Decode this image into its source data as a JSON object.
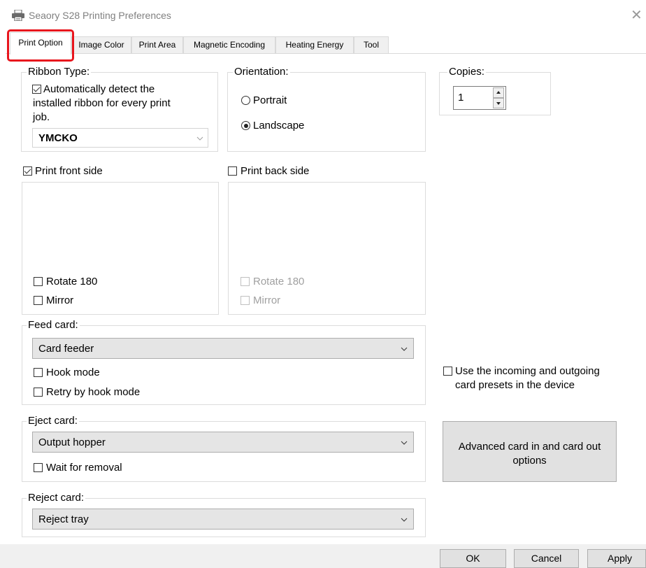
{
  "window": {
    "title": "Seaory S28 Printing Preferences",
    "printer_icon": "printer-icon",
    "close_icon": "close-icon"
  },
  "tabs": [
    {
      "label": "Print Option",
      "active": true
    },
    {
      "label": "Image Color"
    },
    {
      "label": "Print Area"
    },
    {
      "label": "Magnetic Encoding"
    },
    {
      "label": "Heating Energy"
    },
    {
      "label": "Tool"
    }
  ],
  "ribbon": {
    "legend": "Ribbon Type:",
    "auto_detect_line1": "Automatically detect the",
    "auto_detect_line2": "installed ribbon for every print",
    "auto_detect_line3": "job.",
    "auto_detect_checked": true,
    "selected": "YMCKO"
  },
  "orientation": {
    "legend": "Orientation:",
    "portrait": "Portrait",
    "landscape": "Landscape",
    "selected": "Landscape"
  },
  "copies": {
    "legend": "Copies:",
    "value": "1"
  },
  "front": {
    "label": "Print front side",
    "checked": true,
    "rotate": "Rotate 180",
    "mirror": "Mirror"
  },
  "back": {
    "label": "Print back side",
    "checked": false,
    "rotate": "Rotate 180",
    "mirror": "Mirror"
  },
  "feed": {
    "legend": "Feed card:",
    "selected": "Card feeder",
    "hook_mode": "Hook mode",
    "retry_hook": "Retry by hook mode"
  },
  "presets": {
    "line1": "Use the incoming and outgoing",
    "line2": "card presets in the device"
  },
  "eject": {
    "legend": "Eject card:",
    "selected": "Output hopper",
    "wait": "Wait for removal"
  },
  "advanced_button": {
    "line1": "Advanced card in and card out",
    "line2": "options"
  },
  "reject": {
    "legend": "Reject card:",
    "selected": "Reject tray"
  },
  "footer": {
    "ok": "OK",
    "cancel": "Cancel",
    "apply": "Apply"
  },
  "colors": {
    "tab_highlight": "#e8151d",
    "combo_bg": "#e5e5e5",
    "footer_bg": "#f0f0f0"
  }
}
